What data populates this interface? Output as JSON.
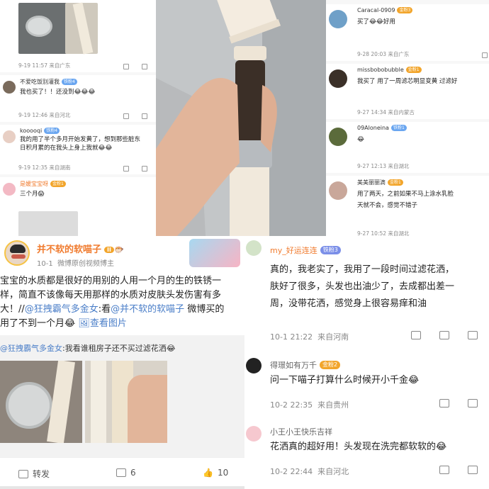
{
  "top_left": {
    "c1": {
      "meta": "9-19 11:57",
      "loc": "来自广东"
    },
    "c2": {
      "name": "不爱吃饭别灌我",
      "badge": "铁粉4",
      "text": "我也买了！！还没到😂😂😂",
      "meta": "9-19 12:46",
      "loc": "来自河北"
    },
    "c3": {
      "name": "kooooqi",
      "badge": "铁粉4",
      "text1": "我的用了半个多月开始发黄了，想到那些脏东",
      "text2": "日积月累的在我头上身上我就😂😂",
      "meta": "9-19 12:35",
      "loc": "来自湖南"
    },
    "c4": {
      "name": "是媛宝宝呀",
      "badge": "金粉1",
      "text": "三个月😱"
    }
  },
  "top_right": {
    "c1": {
      "name": "Caracal-0909",
      "badge": "金粉3",
      "text": "买了😂😂好用",
      "meta": "9-28 20:03",
      "loc": "来自广东"
    },
    "c2": {
      "name": "missbobobubble",
      "badge": "金粉1",
      "text": "我买了 用了一周滤芯明显变黄 过滤好",
      "meta": "9-27 14:34",
      "loc": "来自内蒙古"
    },
    "c3": {
      "name": "09Aloneina",
      "badge": "铁粉1",
      "text": "😂",
      "meta": "9-27 12:13",
      "loc": "来自湖北"
    },
    "c4": {
      "name": "美美丽丽滴",
      "badge": "金粉1",
      "text1": "用了两天，之前如果不马上涂水乳脸",
      "text2": "天就不会，感觉不错子",
      "meta": "9-27 10:52",
      "loc": "来自湖北"
    }
  },
  "post": {
    "author": "并不软的软喵子",
    "level": "II",
    "fans_count": "10-1",
    "author_desc": "微博原创视频博主",
    "text_line1": "宝宝的水质都是很好的用别的人用一个月的生的铁锈一",
    "text_line2": "样，简直不该像每天用那样的水质对皮肤头发伤害有多",
    "text_line3_plain": "大！//",
    "mention1": "@狂拽霸气多金女",
    "text_line3_mid": ":看",
    "mention2": "@并不软的软喵子",
    "text_line3_end": " 微博买的",
    "text_line4": "用了不到一个月😂",
    "view_pics": "查看图片",
    "quote_mention": "@狂拽霸气多金女",
    "quote_text": ":我看谁租房子还不买过滤花洒😂",
    "repost_label": "转发",
    "comment_count": "6",
    "like_count": "10"
  },
  "comments": [
    {
      "name": "my_好运连连",
      "badge": "铁粉3",
      "text1": "真的，我老实了，我用了一段时间过滤花洒，",
      "text2": "肤好了很多，头发也出油少了，去成都出差一",
      "text3": "周，没带花洒，感觉身上很容易痒和油",
      "time": "10-1 21:22",
      "loc": "来自河南"
    },
    {
      "name": "得璟如有万千",
      "badge": "金粉2",
      "text": "问一下喵子打算什么时候开小千金😂",
      "time": "10-2 22:35",
      "loc": "来自贵州"
    },
    {
      "name": "小王小王快乐吉祥",
      "text": "花洒真的超好用！头发现在洗完都软软的😂",
      "time": "10-2 22:44",
      "loc": "来自河北"
    }
  ]
}
